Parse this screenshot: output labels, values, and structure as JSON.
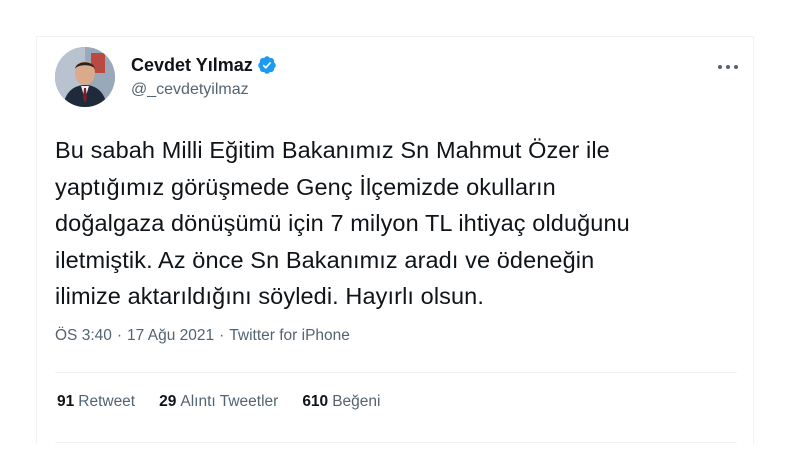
{
  "tweet": {
    "author": {
      "display_name": "Cevdet Yılmaz",
      "handle": "@_cevdetyilmaz",
      "verified_color": "#1d9bf0",
      "avatar_icon": "profile-photo"
    },
    "more_icon": "ellipsis-icon",
    "text": "Bu sabah Milli Eğitim Bakanımız Sn Mahmut Özer ile\nyaptığımız görüşmede Genç İlçemizde okulların\ndoğalgaza dönüşümü için 7 milyon TL ihtiyaç olduğunu\niletmiştik. Az önce Sn Bakanımız aradı ve ödeneğin\nilimize aktarıldığını söyledi. Hayırlı olsun.",
    "time": "ÖS 3:40",
    "separator": "·",
    "date": "17 Ağu 2021",
    "source": "Twitter for iPhone",
    "stats": {
      "retweets": {
        "count": "91",
        "label": "Retweet"
      },
      "quotes": {
        "count": "29",
        "label": "Alıntı Tweetler"
      },
      "likes": {
        "count": "610",
        "label": "Beğeni"
      }
    }
  }
}
